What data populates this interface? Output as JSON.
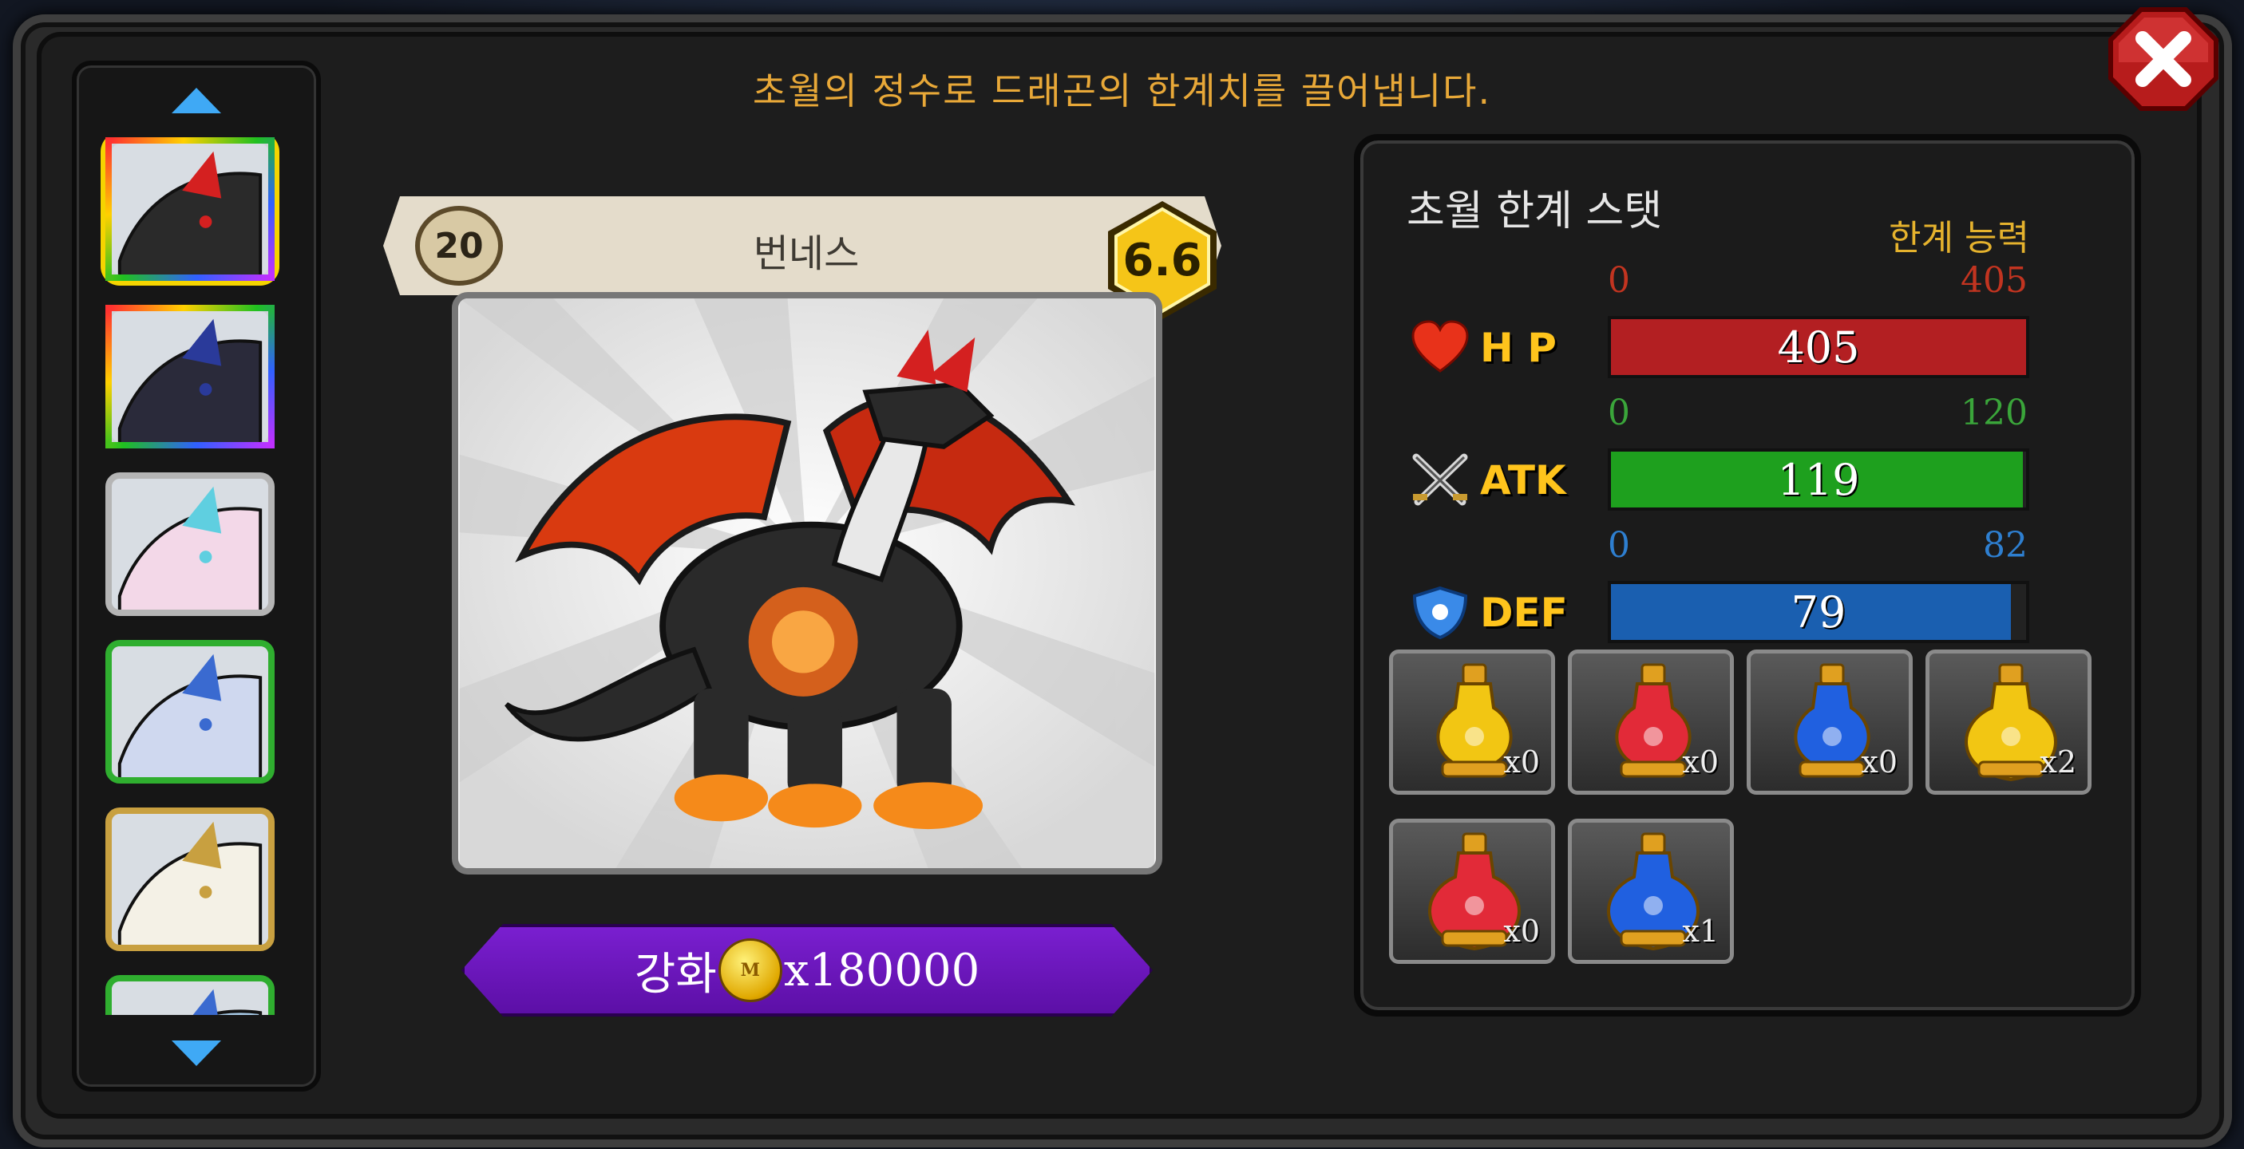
{
  "banner": "초월의 정수로 드래곤의 한계치를 끌어냅니다.",
  "dragon": {
    "name": "번네스",
    "level": "20",
    "grade": "6.6"
  },
  "upgrade": {
    "label": "강화",
    "cost": "x180000",
    "coin_mark": "M"
  },
  "stats": {
    "title": "초월 한계 스탯",
    "subtitle": "한계 능력",
    "rows": [
      {
        "label": "H P",
        "min": "0",
        "max": "405",
        "value": "405",
        "fraction": 1.0,
        "color": "#b31f22",
        "num_color": "#c23420"
      },
      {
        "label": "ATK",
        "min": "0",
        "max": "120",
        "value": "119",
        "fraction": 0.9917,
        "color": "#1ea01e",
        "num_color": "#3aa53a"
      },
      {
        "label": "DEF",
        "min": "0",
        "max": "82",
        "value": "79",
        "fraction": 0.9634,
        "color": "#1a5fb0",
        "num_color": "#2e7fd0"
      }
    ]
  },
  "items": [
    {
      "name": "yellow-potion-small",
      "count": "x0",
      "color": "#f2c613"
    },
    {
      "name": "red-potion-small",
      "count": "x0",
      "color": "#e22a38"
    },
    {
      "name": "blue-potion-small",
      "count": "x0",
      "color": "#2060e0"
    },
    {
      "name": "yellow-potion-large",
      "count": "x2",
      "color": "#f2c613"
    },
    {
      "name": "red-potion-large",
      "count": "x0",
      "color": "#e22a38"
    },
    {
      "name": "blue-potion-large",
      "count": "x1",
      "color": "#2060e0"
    }
  ],
  "dragon_list": [
    {
      "name": "dragon-thumb-1",
      "border": "rainbow",
      "selected": true
    },
    {
      "name": "dragon-thumb-2",
      "border": "rainbow",
      "selected": false
    },
    {
      "name": "dragon-thumb-3",
      "border": "#b5b5b5",
      "selected": false
    },
    {
      "name": "dragon-thumb-4",
      "border": "#2fae2f",
      "selected": false
    },
    {
      "name": "dragon-thumb-5",
      "border": "#c8a040",
      "selected": false
    },
    {
      "name": "dragon-thumb-6",
      "border": "#2fae2f",
      "selected": false
    }
  ]
}
